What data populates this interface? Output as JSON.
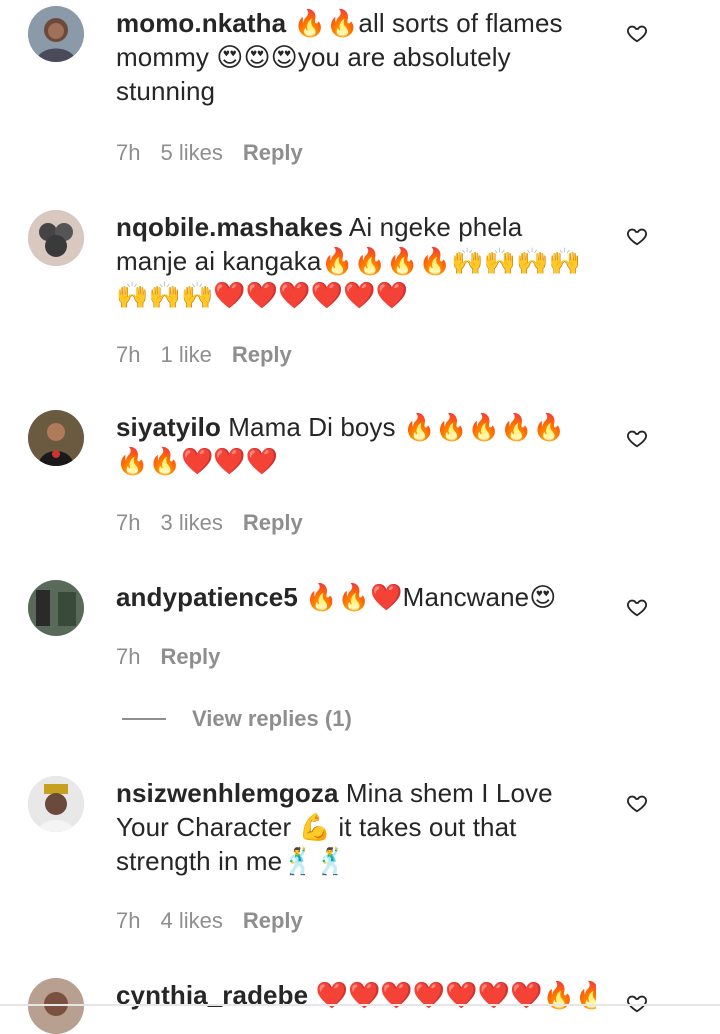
{
  "comments": [
    {
      "username": "momo.nkatha",
      "text": "🔥🔥all sorts of flames mommy 😍😍😍you are absolutely stunning",
      "time": "7h",
      "likes": "5 likes",
      "reply": "Reply",
      "avatar": "avatar-1"
    },
    {
      "username": "nqobile.mashakes",
      "text": "Ai ngeke phela manje ai kangaka🔥🔥🔥🔥🙌🙌🙌🙌🙌🙌🙌❤️❤️❤️❤️❤️❤️",
      "time": "7h",
      "likes": "1 like",
      "reply": "Reply",
      "avatar": "avatar-2"
    },
    {
      "username": "siyatyilo",
      "text": "Mama Di boys 🔥🔥🔥🔥🔥🔥🔥❤️❤️❤️",
      "time": "7h",
      "likes": "3 likes",
      "reply": "Reply",
      "avatar": "avatar-3"
    },
    {
      "username": "andypatience5",
      "text": "🔥🔥❤️Mancwane😍",
      "time": "7h",
      "likes": "",
      "reply": "Reply",
      "avatar": "avatar-4"
    },
    {
      "username": "nsizwenhlemgoza",
      "text": "Mina shem I Love Your Character 💪 it takes out that strength in me🕺🕺",
      "time": "7h",
      "likes": "4 likes",
      "reply": "Reply",
      "avatar": "avatar-5"
    },
    {
      "username": "cynthia_radebe",
      "text": "❤️❤️❤️❤️❤️❤️❤️🔥🔥",
      "avatar": "avatar-6"
    }
  ],
  "view_replies": "View replies (1)",
  "icons": {
    "like": "heart-outline-icon"
  }
}
